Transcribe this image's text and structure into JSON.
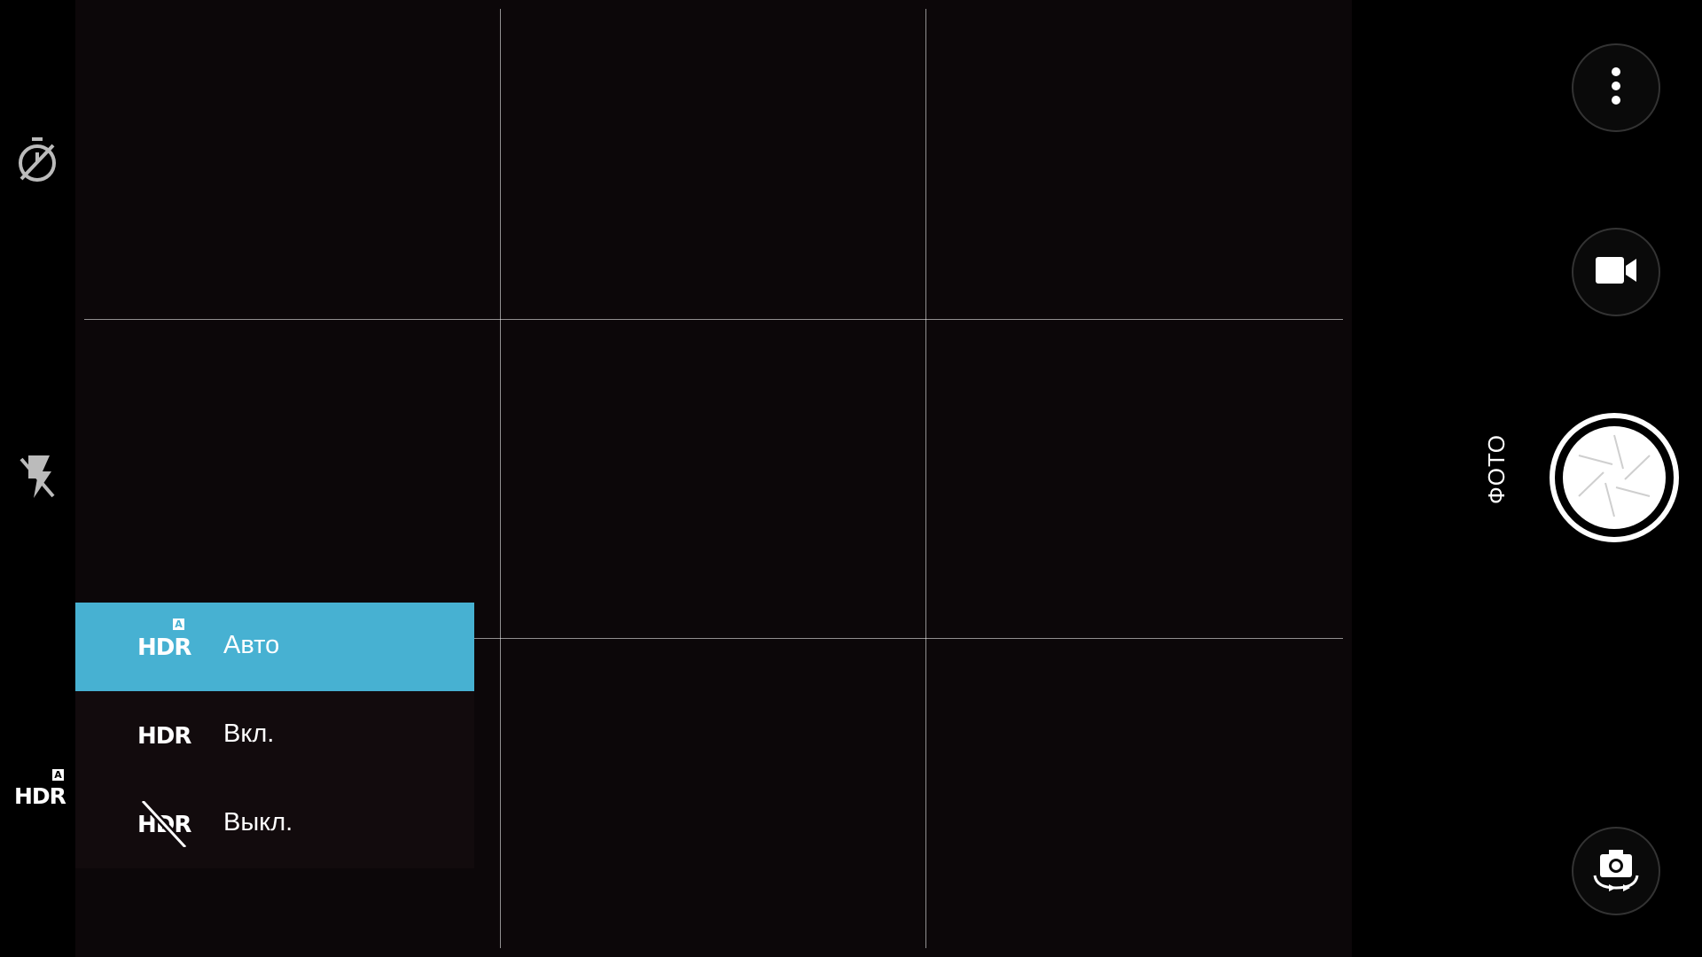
{
  "left_bar": {
    "timer_icon": "timer-off-icon",
    "flash_icon": "flash-off-icon",
    "hdr": {
      "text": "HDR",
      "badge": "A"
    }
  },
  "hdr_menu": {
    "options": [
      {
        "icon_text": "HDR",
        "badge": "A",
        "label": "Авто",
        "selected": true
      },
      {
        "icon_text": "HDR",
        "label": "Вкл.",
        "selected": false
      },
      {
        "icon_text": "HDR",
        "label": "Выкл.",
        "selected": false
      }
    ]
  },
  "right_bar": {
    "mode_label": "ФОТО",
    "more_icon": "more-vertical-icon",
    "video_icon": "video-camera-icon",
    "shutter_icon": "aperture-icon",
    "switch_camera_icon": "switch-camera-icon"
  },
  "colors": {
    "menu_selected": "#47b1d2",
    "viewfinder_bg": "#0c0709"
  }
}
